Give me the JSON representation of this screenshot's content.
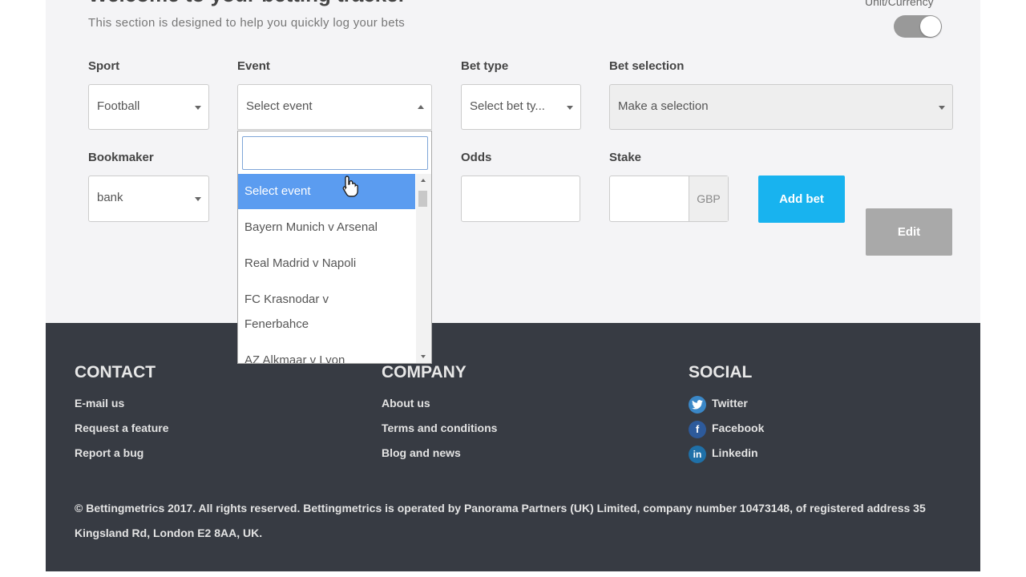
{
  "header": {
    "title": "Welcome to your betting tracker",
    "subtitle": "This section is designed to help you quickly log your bets",
    "unit_currency_label": "Unit/Currency"
  },
  "form": {
    "sport": {
      "label": "Sport",
      "value": "Football"
    },
    "event": {
      "label": "Event",
      "value": "Select event"
    },
    "bet_type": {
      "label": "Bet type",
      "value": "Select bet ty..."
    },
    "bet_selection": {
      "label": "Bet selection",
      "value": "Make a selection"
    },
    "bookmaker": {
      "label": "Bookmaker",
      "value": "bank"
    },
    "odds": {
      "label": "Odds",
      "value": ""
    },
    "stake": {
      "label": "Stake",
      "value": "",
      "currency": "GBP"
    },
    "add_bet_label": "Add bet",
    "edit_label": "Edit"
  },
  "event_dropdown": {
    "search_value": "",
    "items": [
      "Select event",
      "Bayern Munich v Arsenal",
      "Real Madrid v Napoli",
      "FC Krasnodar v",
      "Fenerbahce",
      "AZ Alkmaar v Lyon"
    ]
  },
  "footer": {
    "contact": {
      "heading": "CONTACT",
      "links": [
        "E-mail us",
        "Request a feature",
        "Report a bug"
      ]
    },
    "company": {
      "heading": "COMPANY",
      "links": [
        "About us",
        "Terms and conditions",
        "Blog and news"
      ]
    },
    "social": {
      "heading": "SOCIAL",
      "links": [
        "Twitter",
        "Facebook",
        "Linkedin"
      ],
      "icons": [
        "twitter-icon",
        "facebook-icon",
        "linkedin-icon"
      ]
    },
    "copyright": "© Bettingmetrics 2017. All rights reserved. Bettingmetrics is operated by Panorama Partners (UK) Limited, company number 10473148, of registered address 35 Kingsland Rd, London E2 8AA, UK."
  },
  "colors": {
    "accent": "#18b3ef",
    "dropdown_highlight": "#5b9cf0",
    "footer_bg": "#373b43",
    "panel_bg": "#f4f4f6"
  }
}
